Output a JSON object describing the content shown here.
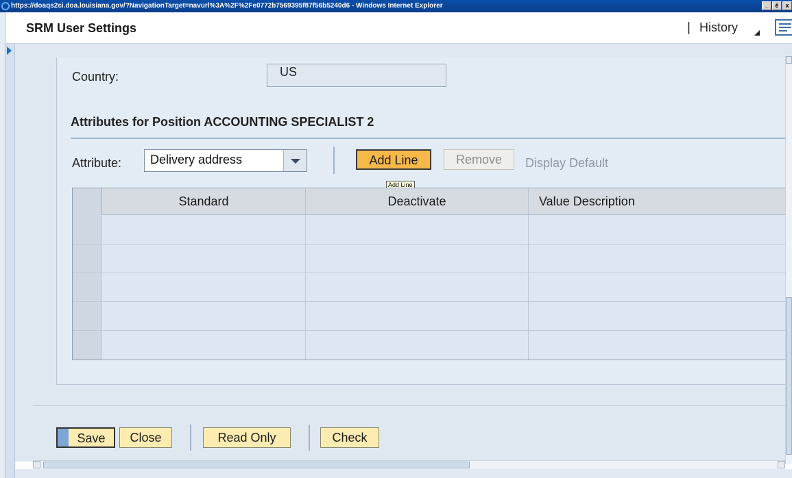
{
  "window": {
    "title": "https://doaqs2ci.doa.louisiana.gov/?NavigationTarget=navurl%3A%2F%2Fe0772b7569395f87f56b5240d6 - Windows Internet Explorer",
    "controls": [
      "_",
      "ē",
      "x"
    ]
  },
  "header": {
    "title": "SRM User Settings",
    "separator": "|",
    "history_label": "History"
  },
  "form": {
    "country_label": "Country:",
    "country_value": "US",
    "section_title": "Attributes for Position ACCOUNTING SPECIALIST 2",
    "attribute_label": "Attribute:",
    "attribute_value": "Delivery address",
    "add_line_label": "Add Line",
    "remove_label": "Remove",
    "display_default_label": "Display Default",
    "tooltip": "Add Line"
  },
  "table": {
    "columns": [
      "Standard",
      "Deactivate",
      "Value Description"
    ],
    "rows": 5
  },
  "footer": {
    "save_label": "Save",
    "close_label": "Close",
    "read_only_label": "Read Only",
    "check_label": "Check"
  },
  "colors": {
    "button_bg": "#fdecb1",
    "button_active_bg": "#f7b84a",
    "panel_bg": "#e3ebf5",
    "titlebar_bg": "#0b3e8c"
  }
}
